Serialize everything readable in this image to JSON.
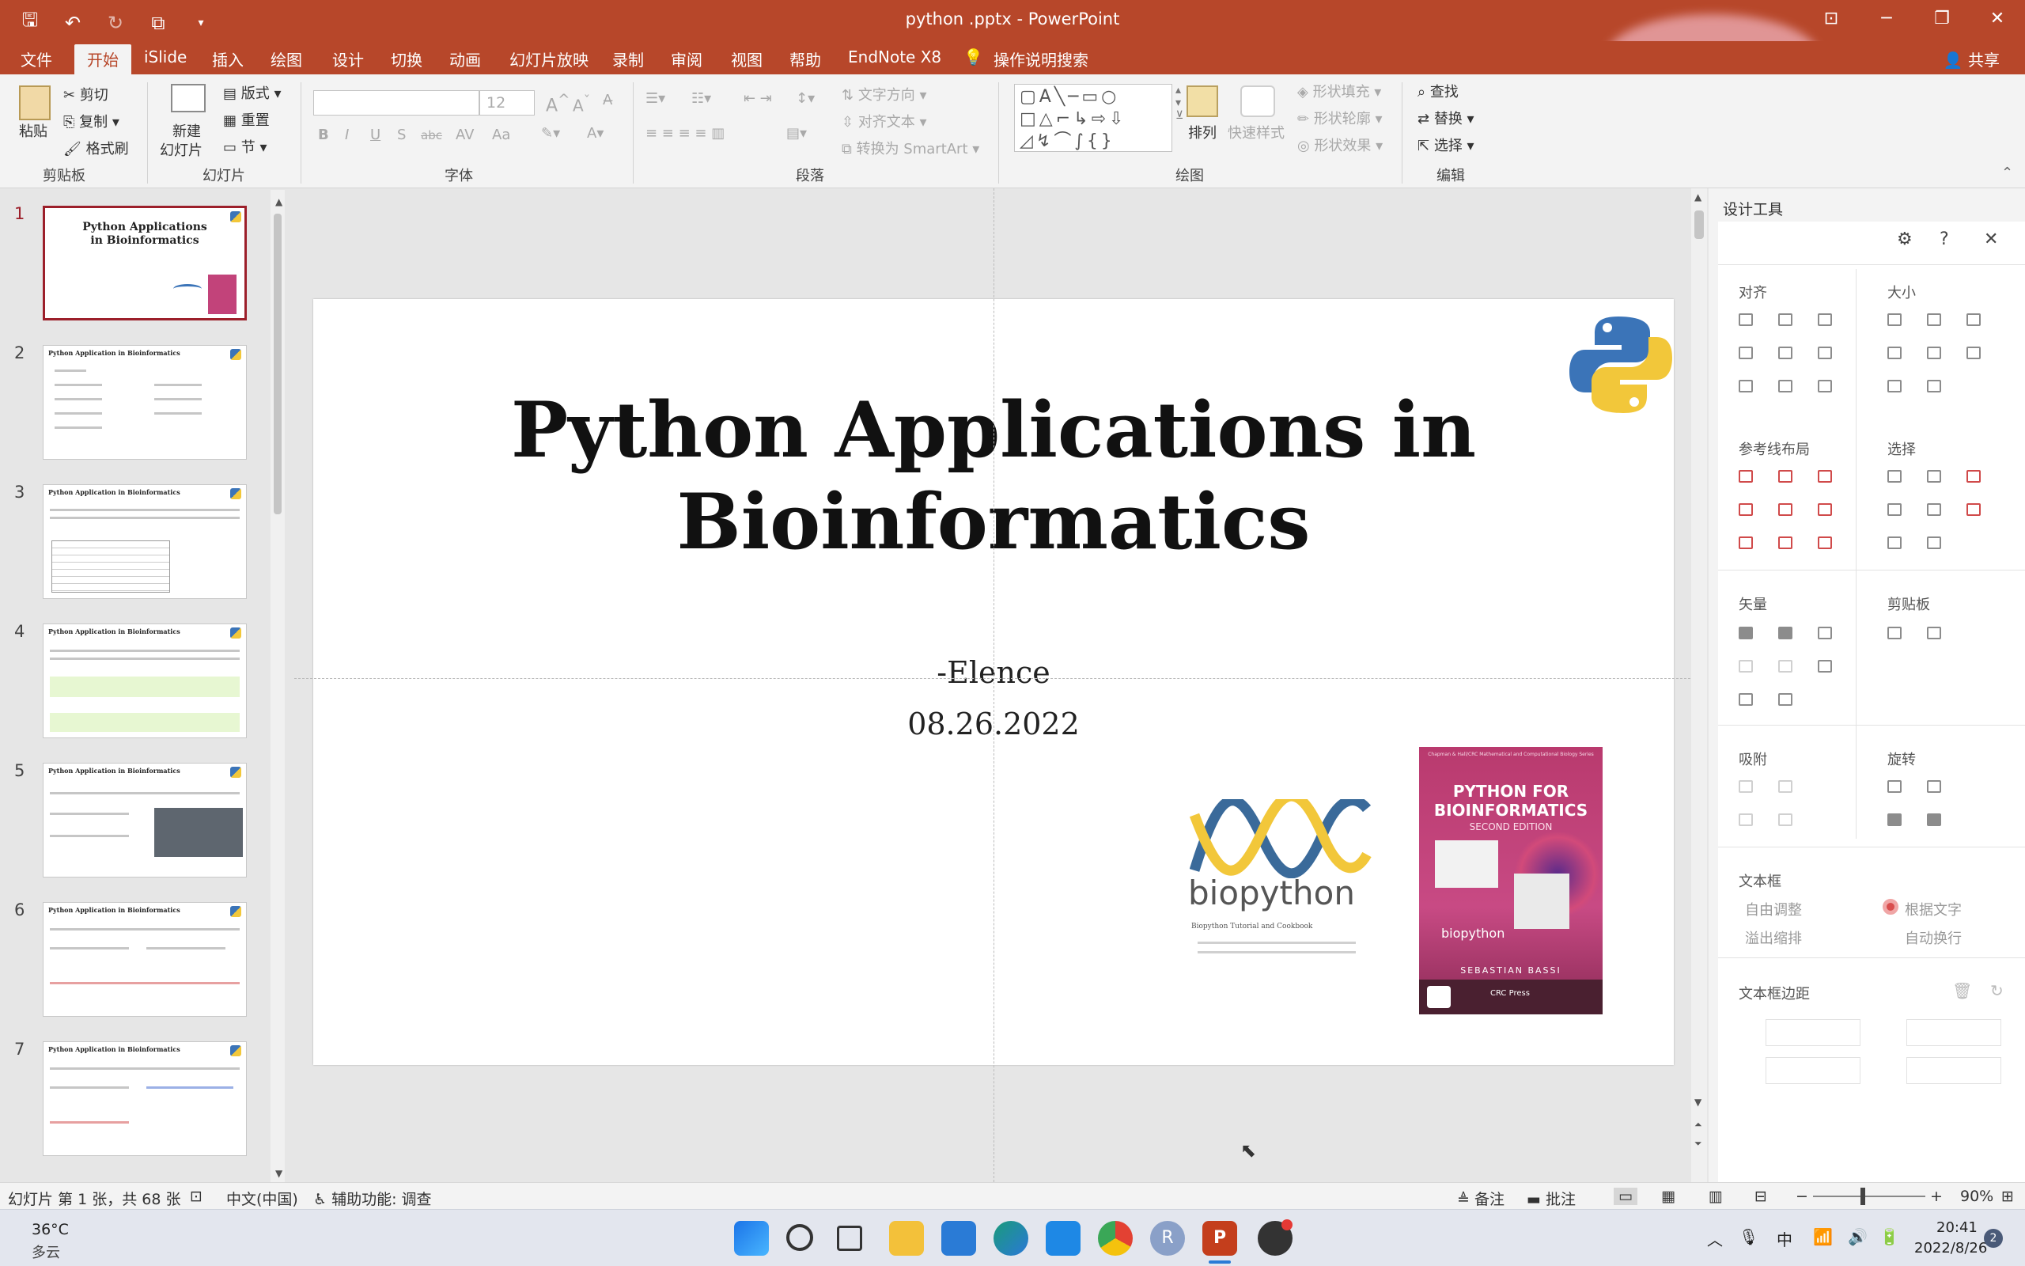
{
  "window": {
    "title": "python .pptx  -  PowerPoint",
    "controls": [
      "restore-ribbon-icon",
      "minimize-icon",
      "maximize-icon",
      "close-icon"
    ]
  },
  "menu": {
    "tabs": [
      "文件",
      "开始",
      "iSlide",
      "插入",
      "绘图",
      "设计",
      "切换",
      "动画",
      "幻灯片放映",
      "录制",
      "审阅",
      "视图",
      "帮助",
      "EndNote X8",
      "操作说明搜索"
    ],
    "share": "共享"
  },
  "ribbon": {
    "clipboard": {
      "paste": "粘贴",
      "cut": "剪切",
      "copy": "复制",
      "format_painter": "格式刷",
      "label": "剪贴板"
    },
    "slides": {
      "new_slide": "新建",
      "new_slide2": "幻灯片",
      "layout": "版式",
      "reset": "重置",
      "section": "节",
      "label": "幻灯片"
    },
    "font": {
      "size": "12",
      "bold": "B",
      "italic": "I",
      "underline": "U",
      "shadow": "S",
      "strike": "abc",
      "spacing": "AV",
      "case": "Aa",
      "label": "字体"
    },
    "paragraph": {
      "text_direction": "文字方向",
      "align_text": "对齐文本",
      "smartart": "转换为 SmartArt",
      "label": "段落"
    },
    "drawing": {
      "arrange": "排列",
      "quick_styles": "快速样式",
      "shape_fill": "形状填充",
      "shape_outline": "形状轮廓",
      "shape_effects": "形状效果",
      "label": "绘图"
    },
    "editing": {
      "find": "查找",
      "replace": "替换",
      "select": "选择",
      "label": "编辑"
    }
  },
  "thumbnails": [
    {
      "num": "1",
      "title": "Python Applications in Bioinformatics"
    },
    {
      "num": "2",
      "title": "Python Application in Bioinformatics"
    },
    {
      "num": "3",
      "title": "Python Application in Bioinformatics"
    },
    {
      "num": "4",
      "title": "Python Application in Bioinformatics"
    },
    {
      "num": "5",
      "title": "Python Application in Bioinformatics"
    },
    {
      "num": "6",
      "title": "Python Application in Bioinformatics"
    },
    {
      "num": "7",
      "title": "Python Application in Bioinformatics"
    }
  ],
  "slide": {
    "title_line1": "Python Applications in",
    "title_line2": "Bioinformatics",
    "author": "-Elence",
    "date": "08.26.2022",
    "biopython_word": "biopython",
    "biopython_caption": "Biopython Tutorial and Cookbook",
    "book_series": "Chapman & Hall/CRC Mathematical and Computational Biology Series",
    "book_title1": "PYTHON FOR",
    "book_title2": "BIOINFORMATICS",
    "book_edition": "SECOND EDITION",
    "book_logo": "biopython",
    "book_author": "SEBASTIAN BASSI",
    "book_publisher": "CRC Press"
  },
  "design_pane": {
    "title": "设计工具",
    "sections": {
      "align": "对齐",
      "size": "大小",
      "guides": "参考线布局",
      "select": "选择",
      "vector": "矢量",
      "clipboard": "剪贴板",
      "snap": "吸附",
      "rotate": "旋转",
      "textbox": "文本框",
      "textbox_margin": "文本框边距"
    },
    "textbox_options": {
      "auto_adjust": "自由调整",
      "fit_text": "根据文字",
      "overflow": "溢出缩排",
      "auto_wrap": "自动换行"
    }
  },
  "status": {
    "slide_info": "幻灯片 第 1 张，共 68 张",
    "language": "中文(中国)",
    "accessibility": "辅助功能: 调查",
    "notes": "备注",
    "comments": "批注",
    "zoom": "90%"
  },
  "taskbar": {
    "weather_temp": "36°C",
    "weather_desc": "多云",
    "time": "20:41",
    "date": "2022/8/26",
    "notif": "2",
    "ime": "中"
  },
  "colors": {
    "accent": "#b7472a",
    "selected_thumb": "#9c1f2a",
    "python_blue": "#3b74b8",
    "python_yellow": "#f2c73a",
    "book_pink": "#c2437a"
  }
}
